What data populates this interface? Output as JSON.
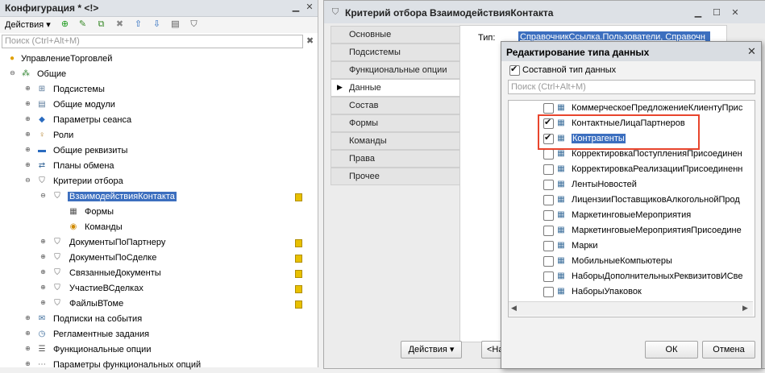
{
  "config_window": {
    "title": "Конфигурация * <!>",
    "actions_label": "Действия",
    "search_placeholder": "Поиск (Ctrl+Alt+M)",
    "tree": [
      {
        "label": "УправлениеТорговлей",
        "icon": "config-icon"
      },
      {
        "label": "Общие",
        "icon": "common-icon"
      },
      {
        "label": "Подсистемы",
        "icon": "subsystems-icon"
      },
      {
        "label": "Общие модули",
        "icon": "modules-icon"
      },
      {
        "label": "Параметры сеанса",
        "icon": "session-params-icon"
      },
      {
        "label": "Роли",
        "icon": "roles-icon"
      },
      {
        "label": "Общие реквизиты",
        "icon": "attributes-icon"
      },
      {
        "label": "Планы обмена",
        "icon": "exchange-plans-icon"
      },
      {
        "label": "Критерии отбора",
        "icon": "filter-criteria-icon"
      },
      {
        "label": "ВзаимодействияКонтакта",
        "icon": "filter-criterion-icon"
      },
      {
        "label": "Формы",
        "icon": "forms-icon"
      },
      {
        "label": "Команды",
        "icon": "commands-icon"
      },
      {
        "label": "ДокументыПоПартнеру",
        "icon": "filter-criterion-icon"
      },
      {
        "label": "ДокументыПоСделке",
        "icon": "filter-criterion-icon"
      },
      {
        "label": "СвязанныеДокументы",
        "icon": "filter-criterion-icon"
      },
      {
        "label": "УчастиеВСделках",
        "icon": "filter-criterion-icon"
      },
      {
        "label": "ФайлыВТоме",
        "icon": "filter-criterion-icon"
      },
      {
        "label": "Подписки на события",
        "icon": "event-subscriptions-icon"
      },
      {
        "label": "Регламентные задания",
        "icon": "scheduled-jobs-icon"
      },
      {
        "label": "Функциональные опции",
        "icon": "functional-options-icon"
      },
      {
        "label": "Параметры функциональных опций",
        "icon": "functional-options-params-icon"
      }
    ]
  },
  "criterion_window": {
    "title": "Критерий отбора ВзаимодействияКонтакта",
    "tabs": [
      "Основные",
      "Подсистемы",
      "Функциональные опции",
      "Данные",
      "Состав",
      "Формы",
      "Команды",
      "Права",
      "Прочее"
    ],
    "active_tab": "Данные",
    "type_label": "Тип:",
    "type_value": "СправочникСсылка.Пользователи, Справочн",
    "actions_button": "Действия",
    "back_button": "<На"
  },
  "dialog": {
    "title": "Редактирование типа данных",
    "composite_label": "Составной тип данных",
    "composite_checked": true,
    "search_placeholder": "Поиск (Ctrl+Alt+M)",
    "items": [
      {
        "label": "КоммерческоеПредложениеКлиентуПрис",
        "checked": false
      },
      {
        "label": "КонтактныеЛицаПартнеров",
        "checked": true
      },
      {
        "label": "Контрагенты",
        "checked": true
      },
      {
        "label": "КорректировкаПоступленияПрисоединен",
        "checked": false
      },
      {
        "label": "КорректировкаРеализацииПрисоединенн",
        "checked": false
      },
      {
        "label": "ЛентыНовостей",
        "checked": false
      },
      {
        "label": "ЛицензииПоставщиковАлкогольнойПрод",
        "checked": false
      },
      {
        "label": "МаркетинговыеМероприятия",
        "checked": false
      },
      {
        "label": "МаркетинговыеМероприятияПрисоедине",
        "checked": false
      },
      {
        "label": "Марки",
        "checked": false
      },
      {
        "label": "МобильныеКомпьютеры",
        "checked": false
      },
      {
        "label": "НаборыДополнительныхРеквизитовИСве",
        "checked": false
      },
      {
        "label": "НаборыУпаковок",
        "checked": false
      }
    ],
    "ok_label": "ОК",
    "cancel_label": "Отмена"
  }
}
